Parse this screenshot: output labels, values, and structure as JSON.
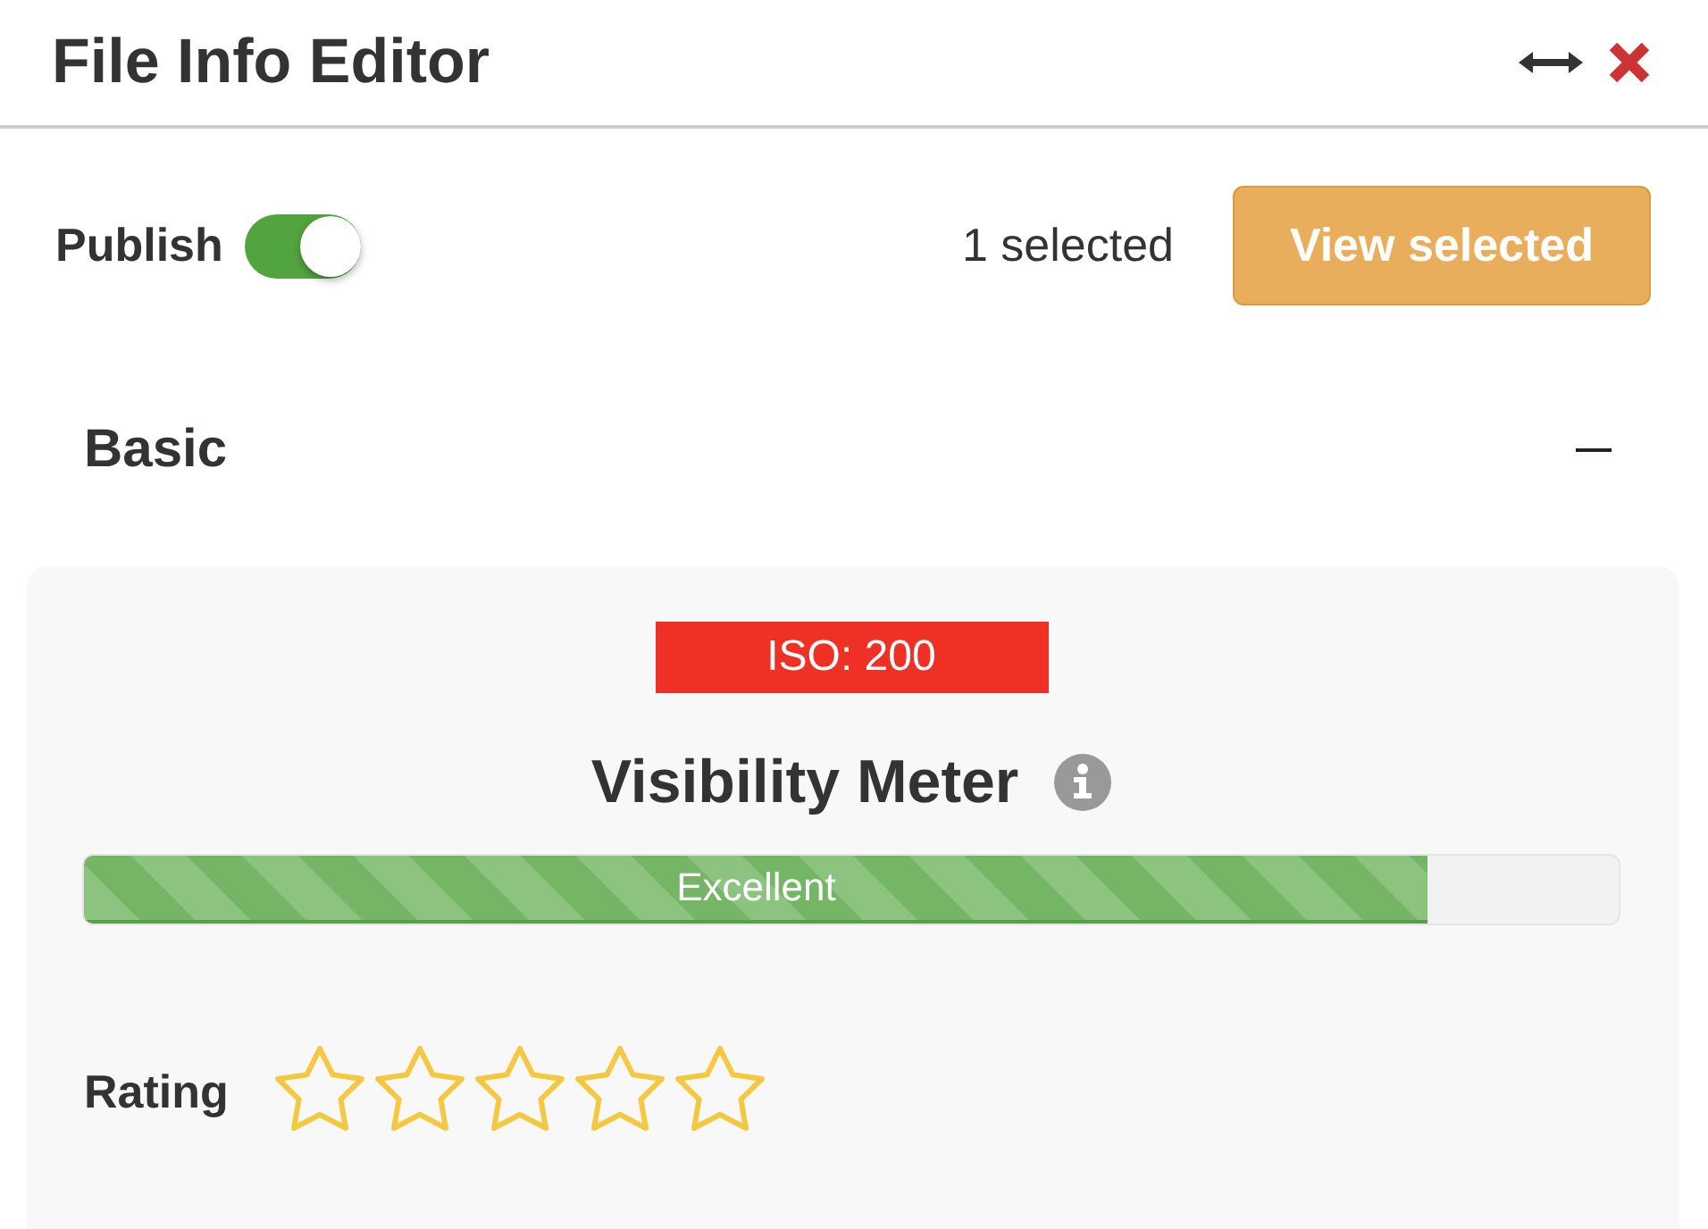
{
  "header": {
    "title": "File Info Editor"
  },
  "toolbar": {
    "publish": {
      "label": "Publish",
      "on": true
    },
    "selection_count": "1 selected",
    "view_button": "View selected"
  },
  "section": {
    "title": "Basic",
    "expanded": true,
    "badge": "ISO: 200",
    "meter": {
      "title": "Visibility Meter",
      "level": 0.876,
      "reading": "Excellent"
    },
    "rating": {
      "label": "Rating",
      "stars": 0
    }
  }
}
